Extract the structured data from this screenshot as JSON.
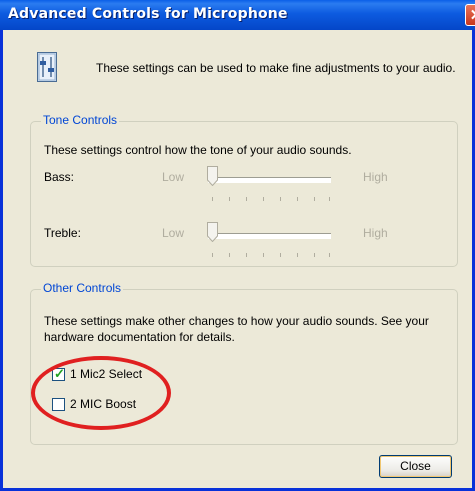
{
  "window": {
    "title": "Advanced Controls for Microphone",
    "close_glyph": "✕"
  },
  "info": {
    "icon": "settings-sliders-icon",
    "text": "These settings can be used to make fine adjustments to your audio."
  },
  "tone_controls": {
    "label": "Tone Controls",
    "description": "These settings control how the tone of your audio sounds.",
    "bass": {
      "label": "Bass:",
      "low": "Low",
      "high": "High",
      "level": 0
    },
    "treble": {
      "label": "Treble:",
      "low": "Low",
      "high": "High",
      "level": 0
    }
  },
  "other_controls": {
    "label": "Other Controls",
    "description": "These settings make other changes to how your audio sounds.  See your hardware documentation for details.",
    "options": [
      {
        "label": "1  Mic2 Select",
        "checked": true
      },
      {
        "label": "2  MIC Boost",
        "checked": false
      }
    ]
  },
  "buttons": {
    "close": "Close"
  },
  "colors": {
    "title_bar": "#0a5fe8",
    "group_label": "#0046d5",
    "highlight_ring": "#e02020",
    "background": "#ece9d8"
  }
}
